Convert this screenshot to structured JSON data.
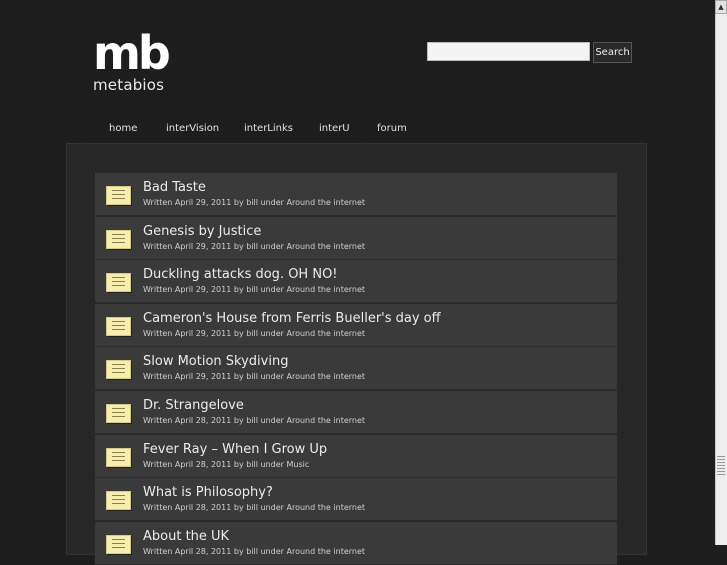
{
  "logo": {
    "mark": "mb",
    "text": "metabios"
  },
  "search": {
    "placeholder": "",
    "button_label": "Search"
  },
  "nav": [
    {
      "label": "home"
    },
    {
      "label": "interVision"
    },
    {
      "label": "interLinks"
    },
    {
      "label": "interU"
    },
    {
      "label": "forum"
    }
  ],
  "posts": [
    {
      "title": "Bad Taste",
      "meta": "Written April 29, 2011 by bill under Around the internet"
    },
    {
      "title": "Genesis by Justice",
      "meta": "Written April 29, 2011 by bill under Around the internet"
    },
    {
      "title": "Duckling attacks dog. OH NO!",
      "meta": "Written April 29, 2011 by bill under Around the internet"
    },
    {
      "title": "Cameron's House from Ferris Bueller's day off",
      "meta": "Written April 29, 2011 by bill under Around the internet"
    },
    {
      "title": "Slow Motion Skydiving",
      "meta": "Written April 29, 2011 by bill under Around the internet"
    },
    {
      "title": "Dr. Strangelove",
      "meta": "Written April 28, 2011 by bill under Around the internet"
    },
    {
      "title": "Fever Ray – When I Grow Up",
      "meta": "Written April 28, 2011 by bill under Music"
    },
    {
      "title": "What is Philosophy?",
      "meta": "Written April 28, 2011 by bill under Around the internet"
    },
    {
      "title": "About the UK",
      "meta": "Written April 28, 2011 by bill under Around the internet"
    }
  ],
  "colors": {
    "background": "#1c1c1c",
    "post_bg": "#3a3a3a",
    "thumb": "#f6eeae"
  }
}
